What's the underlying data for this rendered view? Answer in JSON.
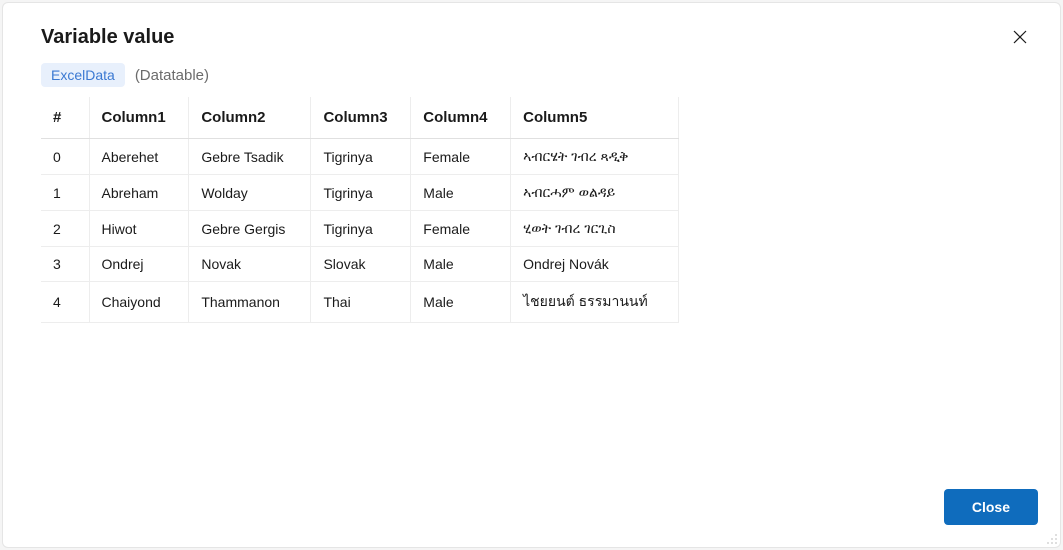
{
  "dialog": {
    "title": "Variable value",
    "varName": "ExcelData",
    "varType": "(Datatable)",
    "closeButtonLabel": "Close"
  },
  "table": {
    "indexHeader": "#",
    "columns": [
      "Column1",
      "Column2",
      "Column3",
      "Column4",
      "Column5"
    ],
    "rows": [
      {
        "index": "0",
        "cells": [
          "Aberehet",
          "Gebre Tsadik",
          "Tigrinya",
          "Female",
          "ኣብርሄት ገብረ ጻዲቅ"
        ]
      },
      {
        "index": "1",
        "cells": [
          "Abreham",
          "Wolday",
          "Tigrinya",
          "Male",
          "ኣብርሓም ወልዳይ"
        ]
      },
      {
        "index": "2",
        "cells": [
          "Hiwot",
          "Gebre Gergis",
          "Tigrinya",
          "Female",
          "ሂወት ገብረ ገርጊስ"
        ]
      },
      {
        "index": "3",
        "cells": [
          "Ondrej",
          "Novak",
          "Slovak",
          "Male",
          "Ondrej Novák"
        ]
      },
      {
        "index": "4",
        "cells": [
          "Chaiyond",
          "Thammanon",
          "Thai",
          "Male",
          "ไชยยนต์ ธรรมานนท์"
        ]
      }
    ]
  }
}
